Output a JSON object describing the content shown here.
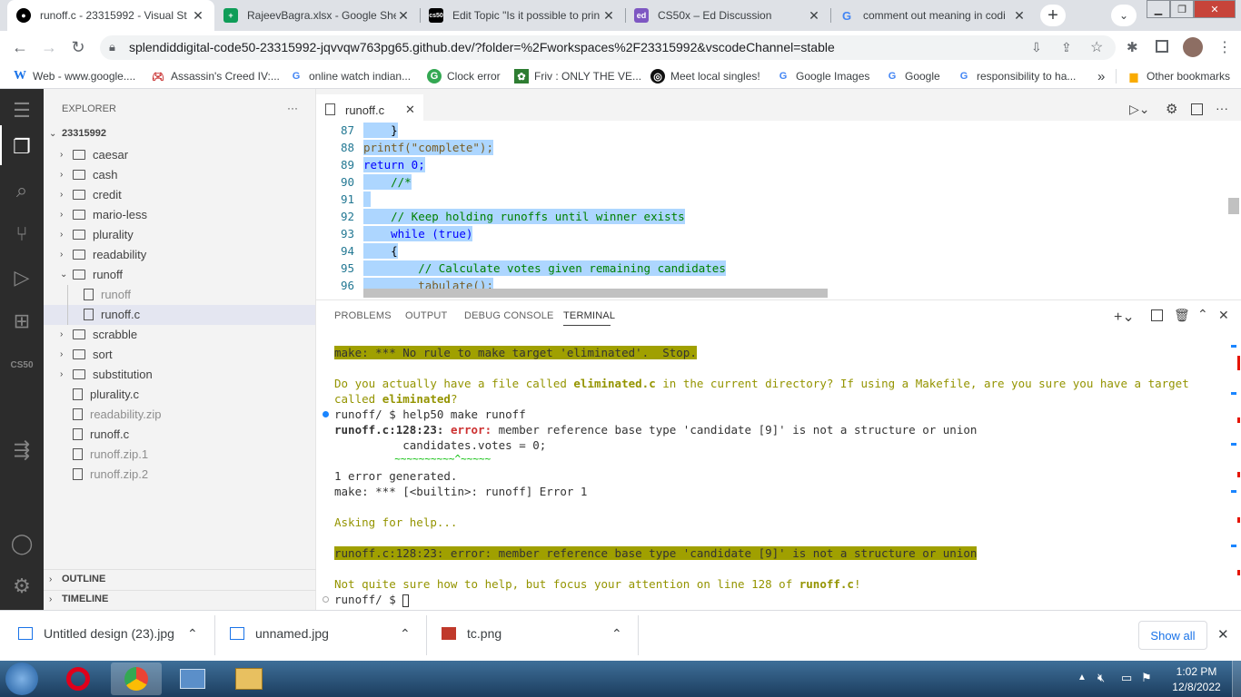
{
  "browser": {
    "tabs": [
      {
        "title": "runoff.c - 23315992 - Visual St",
        "icon": "github-icon",
        "active": true
      },
      {
        "title": "RajeevBagra.xlsx - Google She",
        "icon": "sheets-icon"
      },
      {
        "title": "Edit Topic \"Is it possible to prin",
        "icon": "cs50-icon"
      },
      {
        "title": "CS50x – Ed Discussion",
        "icon": "ed-icon"
      },
      {
        "title": "comment out meaning in codi",
        "icon": "google-icon"
      }
    ],
    "url": "splendiddigital-code50-23315992-jqvvqw763pg65.github.dev/?folder=%2Fworkspaces%2F23315992&vscodeChannel=stable",
    "bookmarks": [
      {
        "label": "Web - www.google....",
        "icon": "w-icon"
      },
      {
        "label": "Assassin's Creed IV:...",
        "icon": "gamepad-icon"
      },
      {
        "label": "online watch indian...",
        "icon": "google-icon"
      },
      {
        "label": "Clock error",
        "icon": "g-icon"
      },
      {
        "label": "Friv : ONLY THE VE...",
        "icon": "friv-icon"
      },
      {
        "label": "Meet local singles!",
        "icon": "globe-icon"
      },
      {
        "label": "Google Images",
        "icon": "google-icon"
      },
      {
        "label": "Google",
        "icon": "google-icon"
      },
      {
        "label": "responsibility to ha...",
        "icon": "google-icon"
      }
    ],
    "other_bookmarks": "Other bookmarks",
    "overflow": "»"
  },
  "vscode": {
    "explorer_title": "EXPLORER",
    "explorer_more": "···",
    "workspace": "23315992",
    "tree": [
      {
        "label": "caesar",
        "type": "folder"
      },
      {
        "label": "cash",
        "type": "folder"
      },
      {
        "label": "credit",
        "type": "folder"
      },
      {
        "label": "mario-less",
        "type": "folder"
      },
      {
        "label": "plurality",
        "type": "folder"
      },
      {
        "label": "readability",
        "type": "folder"
      },
      {
        "label": "runoff",
        "type": "folder-open"
      },
      {
        "label": "runoff",
        "type": "file-child"
      },
      {
        "label": "runoff.c",
        "type": "file-child-selected"
      },
      {
        "label": "scrabble",
        "type": "folder"
      },
      {
        "label": "sort",
        "type": "folder"
      },
      {
        "label": "substitution",
        "type": "folder"
      },
      {
        "label": "plurality.c",
        "type": "file"
      },
      {
        "label": "readability.zip",
        "type": "file-dim"
      },
      {
        "label": "runoff.c",
        "type": "file"
      },
      {
        "label": "runoff.zip.1",
        "type": "file-dim"
      },
      {
        "label": "runoff.zip.2",
        "type": "file-dim"
      }
    ],
    "outline": "OUTLINE",
    "timeline": "TIMELINE",
    "activity_label_cs50": "CS50",
    "editor_tab": "runoff.c",
    "code_lines": [
      {
        "n": "87",
        "text": "    }"
      },
      {
        "n": "88",
        "text": "printf(\"complete\");"
      },
      {
        "n": "89",
        "text": "return 0;"
      },
      {
        "n": "90",
        "text": "    //*"
      },
      {
        "n": "91",
        "text": " "
      },
      {
        "n": "92",
        "text": "    // Keep holding runoffs until winner exists"
      },
      {
        "n": "93",
        "text": "    while (true)"
      },
      {
        "n": "94",
        "text": "    {"
      },
      {
        "n": "95",
        "text": "        // Calculate votes given remaining candidates"
      },
      {
        "n": "96",
        "text": "        tabulate();"
      }
    ],
    "panel_tabs": [
      "PROBLEMS",
      "OUTPUT",
      "DEBUG CONSOLE",
      "TERMINAL"
    ],
    "terminal": {
      "line1": "make: *** No rule to make target 'eliminated'.  Stop.",
      "line2a": "Do you actually have a file called ",
      "line2b": "eliminated.c",
      "line2c": " in the current directory? If using a Makefile, are you sure you have a target",
      "line3a": "called ",
      "line3b": "eliminated",
      "line3c": "?",
      "prompt1": "runoff/ $ help50 make runoff",
      "err_loc": "runoff.c:128:23: ",
      "err_word": "error:",
      "err_msg": " member reference base type 'candidate [9]' is not a structure or union",
      "code_ctx": "          candidates.votes = 0;",
      "squiggle": "          ~~~~~~~~~~^~~~~~",
      "gen": "1 error generated.",
      "make_err": "make: *** [<builtin>: runoff] Error 1",
      "asking": "Asking for help...",
      "hl_err": "runoff.c:128:23: error: member reference base type 'candidate [9]' is not a structure or union",
      "focus_a": "Not quite sure how to help, but focus your attention on line 128 of ",
      "focus_b": "runoff.c",
      "focus_c": "!",
      "prompt2": "runoff/ $ "
    }
  },
  "downloads": [
    {
      "name": "Untitled design (23).jpg"
    },
    {
      "name": "unnamed.jpg"
    },
    {
      "name": "tc.png"
    }
  ],
  "show_all": "Show all",
  "clock": {
    "time": "1:02 PM",
    "date": "12/8/2022"
  }
}
